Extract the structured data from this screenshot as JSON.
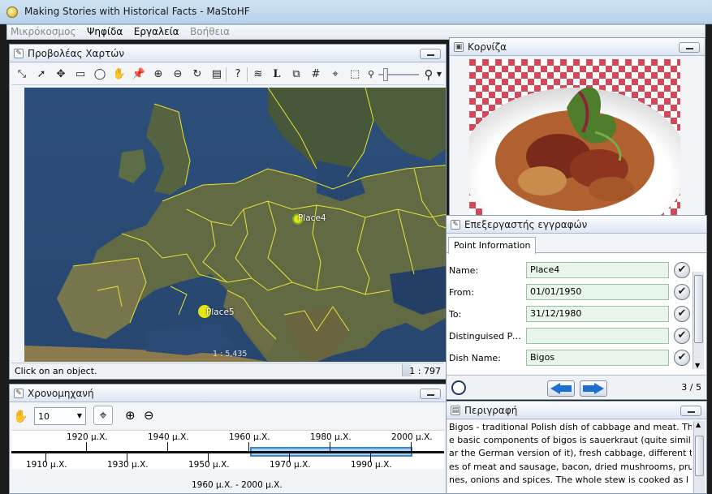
{
  "window": {
    "title": "Making Stories with Historical Facts - MaStoHF"
  },
  "menu": {
    "items": [
      "Μικρόκοσμος",
      "Ψηφίδα",
      "Εργαλεία",
      "Βοήθεια"
    ]
  },
  "map_panel": {
    "title": "Προβολέας Χαρτών",
    "places": [
      {
        "label": "Place4"
      },
      {
        "label": "Place5"
      }
    ],
    "scale_overlay": "1 : 5,435",
    "status_message": "Click on an object.",
    "status_scale": "1 : 797",
    "tools": [
      "select-tool-icon",
      "arrow-icon",
      "pan-hand-icon",
      "rectangle-select-icon",
      "circle-select-icon",
      "grab-hand-icon",
      "pin-icon",
      "zoom-in-icon",
      "zoom-out-icon",
      "refresh-icon",
      "ruler-icon",
      "info-pointer-icon",
      "layers-icon",
      "label-icon",
      "box-zoom-icon",
      "grid-icon",
      "target-icon",
      "zoom-extent-icon",
      "small-magnifier-icon",
      "zoom-slider",
      "large-magnifier-icon"
    ]
  },
  "image_panel": {
    "title": "Κορνίζα"
  },
  "record_editor": {
    "title": "Επεξεργαστής εγγραφών",
    "tab": "Point Information",
    "fields": [
      {
        "label": "Name:",
        "value": "Place4"
      },
      {
        "label": "From:",
        "value": "01/01/1950"
      },
      {
        "label": "To:",
        "value": "31/12/1980"
      },
      {
        "label": "Distinguised Pers...",
        "value": ""
      },
      {
        "label": "Dish Name:",
        "value": "Bigos"
      }
    ],
    "page_indicator": "3 / 5"
  },
  "timeline_panel": {
    "title": "Χρονομηχανή",
    "zoom_value": "10",
    "upper_labels": [
      "1920 μ.Χ.",
      "1940 μ.Χ.",
      "1960 μ.Χ.",
      "1980 μ.Χ.",
      "2000 μ.Χ."
    ],
    "lower_labels": [
      "1910 μ.Χ.",
      "1930 μ.Χ.",
      "1950 μ.Χ.",
      "1970 μ.Χ.",
      "1990 μ.Χ."
    ],
    "selected_range": "1960 μ.Χ. - 2000 μ.Χ."
  },
  "description_panel": {
    "title": "Περιγραφή",
    "lines": [
      "Bigos - traditional Polish dish of cabbage and meat. Th",
      "e basic components of bigos is sauerkraut (quite simil",
      "ar the German version of it), fresh cabbage, different typ",
      "es of meat and sausage, bacon, dried mushrooms, pru",
      "nes, onions and spices. The whole stew is cooked as l"
    ]
  },
  "colors": {
    "place_marker": "#e8e414",
    "border_lines": "#e9e236",
    "accent_blue": "#1f6fd0"
  }
}
